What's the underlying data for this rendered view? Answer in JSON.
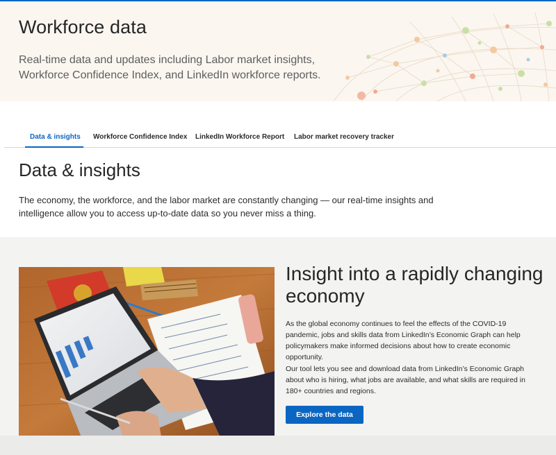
{
  "hero": {
    "title": "Workforce data",
    "description": "Real-time data and updates including Labor market insights, Workforce Confidence Index, and LinkedIn workforce reports."
  },
  "tabs": [
    {
      "label": "Data & insights",
      "active": true
    },
    {
      "label": "Workforce Confidence Index",
      "active": false
    },
    {
      "label": "LinkedIn Workforce Report",
      "active": false
    },
    {
      "label": "Labor market recovery tracker",
      "active": false
    }
  ],
  "section": {
    "title": "Data & insights",
    "description": "The economy, the workforce, and the labor market are constantly changing — our real-time insights and intelligence allow you to access up-to-date data so you never miss a thing."
  },
  "feature": {
    "title": "Insight into a rapidly changing economy",
    "paragraph1": "As the global economy continues to feel the effects of the COVID-19 pandemic, jobs and skills data from LinkedIn’s Economic Graph can help policymakers make informed decisions about how to create economic opportunity.",
    "paragraph2": "Our tool lets you see and download data from LinkedIn’s Economic Graph about who is hiring, what jobs are available, and what skills are required in 180+ countries and regions.",
    "cta_label": "Explore the data"
  },
  "colors": {
    "accent": "#0a66c2",
    "hero_bg": "#fbf6f0",
    "feature_bg": "#f3f3f2"
  }
}
